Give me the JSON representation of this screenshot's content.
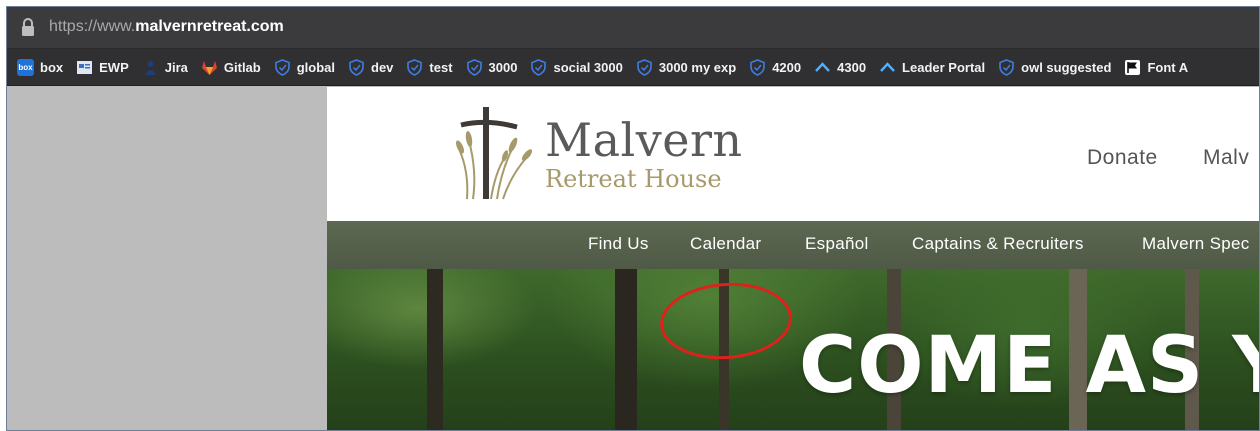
{
  "browser": {
    "url_prefix": "https://www.",
    "url_domain": "malvernretreat.com",
    "bookmarks": [
      {
        "label": "box",
        "icon": "box-icon"
      },
      {
        "label": "EWP",
        "icon": "doc-icon"
      },
      {
        "label": "Jira",
        "icon": "jira-icon"
      },
      {
        "label": "Gitlab",
        "icon": "gitlab-icon"
      },
      {
        "label": "global",
        "icon": "shield-icon"
      },
      {
        "label": "dev",
        "icon": "shield-icon"
      },
      {
        "label": "test",
        "icon": "shield-icon"
      },
      {
        "label": "3000",
        "icon": "shield-icon"
      },
      {
        "label": "social 3000",
        "icon": "shield-icon"
      },
      {
        "label": "3000 my exp",
        "icon": "shield-icon"
      },
      {
        "label": "4200",
        "icon": "shield-icon"
      },
      {
        "label": "4300",
        "icon": "caret-icon"
      },
      {
        "label": "Leader Portal",
        "icon": "caret-icon"
      },
      {
        "label": "owl suggested",
        "icon": "shield-icon"
      },
      {
        "label": "Font A",
        "icon": "flag-icon"
      }
    ]
  },
  "site": {
    "logo_title": "Malvern",
    "logo_subtitle": "Retreat House",
    "header_links": [
      "Donate",
      "Malv"
    ],
    "nav": [
      "Find Us",
      "Calendar",
      "Español",
      "Captains & Recruiters",
      "Malvern Spec"
    ],
    "hero_text": "COME AS YO"
  },
  "colors": {
    "annotation_circle": "#e0201b",
    "nav_bg": "#56614c",
    "logo_gold": "#a69a6a"
  }
}
